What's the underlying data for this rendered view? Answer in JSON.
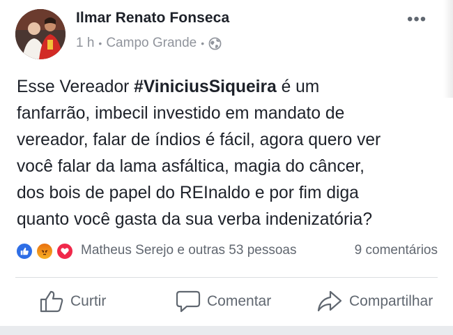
{
  "post": {
    "author": "Ilmar Renato Fonseca",
    "time": "1 h",
    "location": "Campo Grande",
    "more_label": "•••",
    "text_lines": [
      {
        "before": "Esse Vereador ",
        "hashtag": "#ViniciusSiqueira",
        "after": " é um"
      },
      {
        "before": "fanfarrão, imbecil investido em mandato de"
      },
      {
        "before": "vereador, falar de índios é fácil, agora quero ver"
      },
      {
        "before": "você falar da lama asfáltica, magia do câncer,"
      },
      {
        "before": "dos bois de papel do REInaldo e por fim diga"
      },
      {
        "before": "quanto você gasta da sua verba indenizatória?"
      }
    ]
  },
  "reactions": {
    "icons": [
      "like-icon",
      "angry-icon",
      "love-icon"
    ],
    "colors": {
      "like": "#2e6ee6",
      "angry": "#f29a1b",
      "love": "#f0284a"
    },
    "summary": "Matheus Serejo e outras 53 pessoas",
    "comments": "9 comentários"
  },
  "actions": {
    "like_label": "Curtir",
    "comment_label": "Comentar",
    "share_label": "Compartilhar"
  }
}
